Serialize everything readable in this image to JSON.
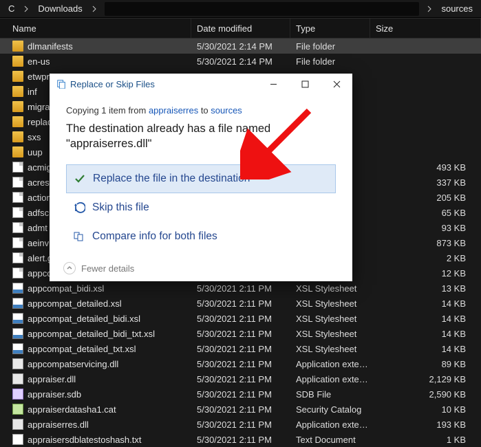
{
  "breadcrumbs": {
    "c0": "C",
    "c1": "Downloads",
    "c2": "sources"
  },
  "columns": {
    "name": "Name",
    "date": "Date modified",
    "type": "Type",
    "size": "Size"
  },
  "files": [
    {
      "icon": "folder",
      "name": "dlmanifests",
      "date": "5/30/2021 2:14 PM",
      "type": "File folder",
      "size": "",
      "sel": true
    },
    {
      "icon": "folder",
      "name": "en-us",
      "date": "5/30/2021 2:14 PM",
      "type": "File folder",
      "size": ""
    },
    {
      "icon": "folder",
      "name": "etwpr",
      "date": "",
      "type": "",
      "size": ""
    },
    {
      "icon": "folder",
      "name": "inf",
      "date": "",
      "type": "",
      "size": ""
    },
    {
      "icon": "folder",
      "name": "migra",
      "date": "",
      "type": "",
      "size": ""
    },
    {
      "icon": "folder",
      "name": "replac",
      "date": "",
      "type": "",
      "size": ""
    },
    {
      "icon": "folder",
      "name": "sxs",
      "date": "",
      "type": "",
      "size": ""
    },
    {
      "icon": "folder",
      "name": "uup",
      "date": "",
      "type": "",
      "size": ""
    },
    {
      "icon": "file",
      "name": "acmig",
      "date": "",
      "type": "",
      "size": "493 KB"
    },
    {
      "icon": "file",
      "name": "acres.",
      "date": "",
      "type": "",
      "size": "337 KB"
    },
    {
      "icon": "file",
      "name": "action",
      "date": "",
      "type": "",
      "size": "205 KB"
    },
    {
      "icon": "file",
      "name": "adfsc",
      "date": "",
      "type": "",
      "size": "65 KB"
    },
    {
      "icon": "file",
      "name": "admt",
      "date": "",
      "type": "",
      "size": "93 KB"
    },
    {
      "icon": "file",
      "name": "aeinv",
      "date": "",
      "type": "",
      "size": "873 KB"
    },
    {
      "icon": "file",
      "name": "alert.g",
      "date": "",
      "type": "",
      "size": "2 KB"
    },
    {
      "icon": "file",
      "name": "appco",
      "date": "",
      "type": "",
      "size": "12 KB"
    },
    {
      "icon": "xsl",
      "name": "appcompat_bidi.xsl",
      "date": "5/30/2021 2:11 PM",
      "type": "XSL Stylesheet",
      "size": "13 KB"
    },
    {
      "icon": "xsl",
      "name": "appcompat_detailed.xsl",
      "date": "5/30/2021 2:11 PM",
      "type": "XSL Stylesheet",
      "size": "14 KB"
    },
    {
      "icon": "xsl",
      "name": "appcompat_detailed_bidi.xsl",
      "date": "5/30/2021 2:11 PM",
      "type": "XSL Stylesheet",
      "size": "14 KB"
    },
    {
      "icon": "xsl",
      "name": "appcompat_detailed_bidi_txt.xsl",
      "date": "5/30/2021 2:11 PM",
      "type": "XSL Stylesheet",
      "size": "14 KB"
    },
    {
      "icon": "xsl",
      "name": "appcompat_detailed_txt.xsl",
      "date": "5/30/2021 2:11 PM",
      "type": "XSL Stylesheet",
      "size": "14 KB"
    },
    {
      "icon": "dll",
      "name": "appcompatservicing.dll",
      "date": "5/30/2021 2:11 PM",
      "type": "Application exten...",
      "size": "89 KB"
    },
    {
      "icon": "dll",
      "name": "appraiser.dll",
      "date": "5/30/2021 2:11 PM",
      "type": "Application exten...",
      "size": "2,129 KB"
    },
    {
      "icon": "sdb",
      "name": "appraiser.sdb",
      "date": "5/30/2021 2:11 PM",
      "type": "SDB File",
      "size": "2,590 KB"
    },
    {
      "icon": "cat",
      "name": "appraiserdatasha1.cat",
      "date": "5/30/2021 2:11 PM",
      "type": "Security Catalog",
      "size": "10 KB"
    },
    {
      "icon": "dll",
      "name": "appraiserres.dll",
      "date": "5/30/2021 2:11 PM",
      "type": "Application exten...",
      "size": "193 KB"
    },
    {
      "icon": "txt",
      "name": "appraisersdblatestoshash.txt",
      "date": "5/30/2021 2:11 PM",
      "type": "Text Document",
      "size": "1 KB"
    }
  ],
  "dialog": {
    "title": "Replace or Skip Files",
    "copying_prefix": "Copying 1 item from ",
    "copying_src": "appraiserres",
    "copying_mid": " to ",
    "copying_dest": "sources",
    "message": "The destination already has a file named \"appraiserres.dll\"",
    "opt_replace": "Replace the file in the destination",
    "opt_skip": "Skip this file",
    "opt_compare": "Compare info for both files",
    "fewer": "Fewer details"
  }
}
